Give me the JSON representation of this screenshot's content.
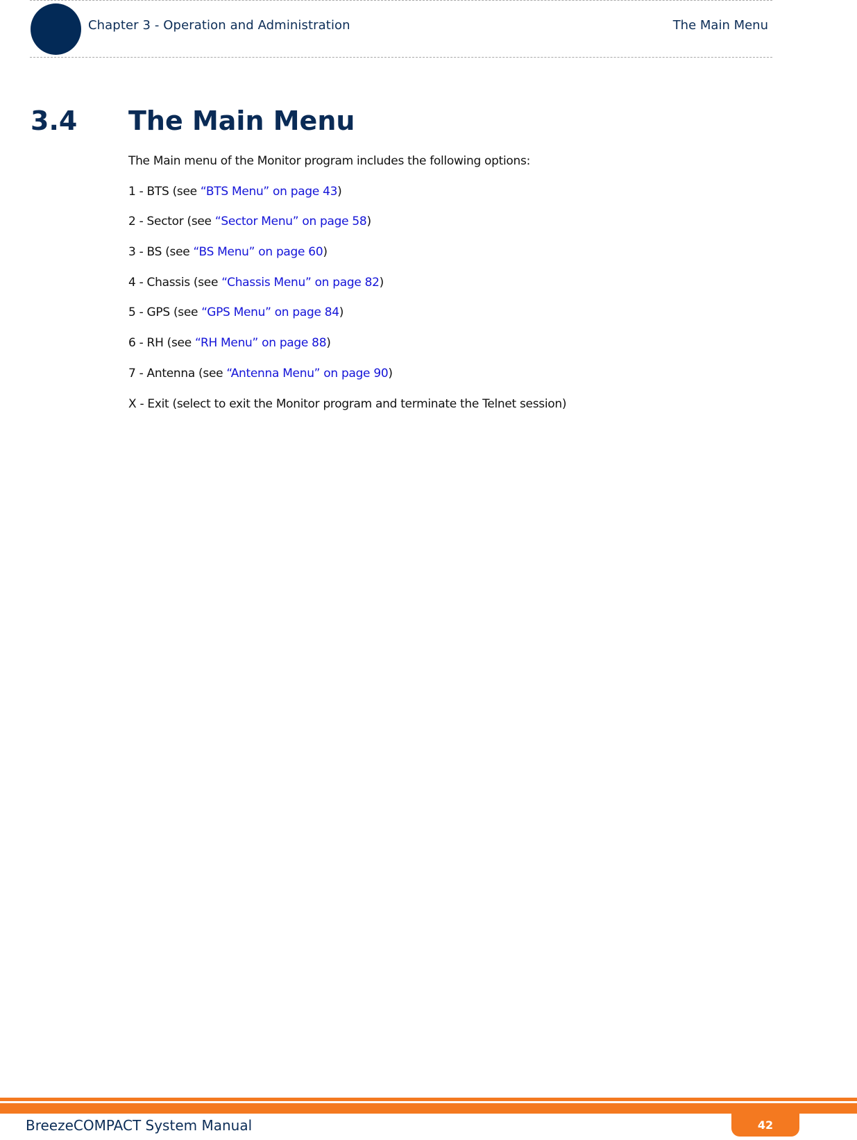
{
  "header": {
    "chapter": "Chapter 3 - Operation and Administration",
    "section": "The Main Menu",
    "accent_color": "#032a57"
  },
  "section": {
    "number": "3.4",
    "title": "The Main Menu"
  },
  "intro": "The Main menu of the Monitor program includes the following options:",
  "items": [
    {
      "prefix": "1 - BTS (see ",
      "link": "“BTS Menu” on page 43",
      "suffix": ")"
    },
    {
      "prefix": "2 - Sector (see ",
      "link": "“Sector Menu” on page 58",
      "suffix": ")"
    },
    {
      "prefix": "3 - BS (see ",
      "link": "“BS Menu” on page 60",
      "suffix": ")"
    },
    {
      "prefix": "4 - Chassis (see ",
      "link": "“Chassis Menu” on page 82",
      "suffix": ")"
    },
    {
      "prefix": "5 - GPS (see ",
      "link": "“GPS Menu” on page 84",
      "suffix": ")"
    },
    {
      "prefix": "6 - RH (see ",
      "link": "“RH Menu” on page 88",
      "suffix": ")"
    },
    {
      "prefix": "7 - Antenna (see ",
      "link": "“Antenna Menu” on page 90",
      "suffix": ")"
    }
  ],
  "exit_item": "X - Exit (select to exit the Monitor program and terminate the Telnet session)",
  "footer": {
    "manual_title": "BreezeCOMPACT System Manual",
    "page_number": "42",
    "accent_color": "#f47920"
  },
  "link_color": "#1414d8"
}
